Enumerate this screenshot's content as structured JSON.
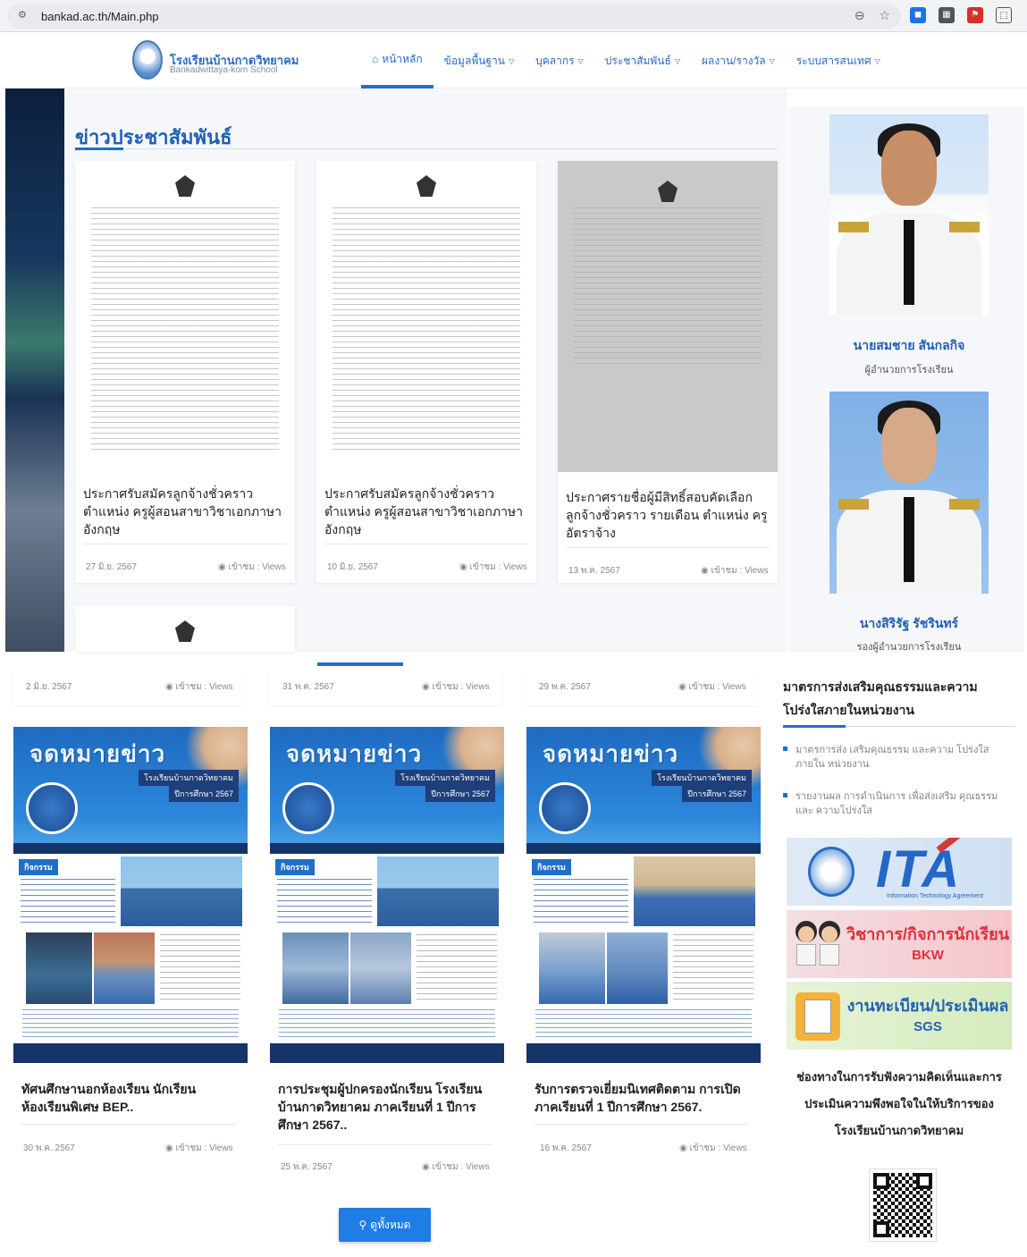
{
  "browser": {
    "url": "bankad.ac.th/Main.php"
  },
  "site": {
    "school_name": "โรงเรียนบ้านกาดวิทยาคม",
    "school_sub": "Bankadwittaya-kom School"
  },
  "nav": {
    "items": [
      {
        "label": "หน้าหลัก",
        "icon": "home-icon",
        "active": true,
        "dropdown": false
      },
      {
        "label": "ข้อมูลพื้นฐาน",
        "dropdown": true
      },
      {
        "label": "บุคลากร",
        "dropdown": true
      },
      {
        "label": "ประชาสัมพันธ์",
        "dropdown": true
      },
      {
        "label": "ผลงาน/รางวัล",
        "dropdown": true
      },
      {
        "label": "ระบบสารสนเทศ",
        "dropdown": true
      }
    ]
  },
  "news": {
    "section_title": "ข่าวประชาสัมพันธ์",
    "cards": [
      {
        "title": "ประกาศรับสมัครลูกจ้างชั่วคราว ตำแหน่ง ครูผู้สอนสาขาวิชาเอกภาษาอังกฤษ",
        "date": "27 มิ.ย. 2567",
        "views": "เข้าชม : Views"
      },
      {
        "title": "ประกาศรับสมัครลูกจ้างชั่วคราว ตำแหน่ง ครูผู้สอนสาขาวิชาเอกภาษาอังกฤษ",
        "date": "10 มิ.ย. 2567",
        "views": "เข้าชม : Views"
      },
      {
        "title": "ประกาศรายชื่อผู้มีสิทธิ์สอบคัดเลือก ลูกจ้างชั่วคราว รายเดือน ตำแหน่ง ครูอัตราจ้าง",
        "date": "13 พ.ค. 2567",
        "views": "เข้าชม : Views"
      }
    ],
    "strip": [
      {
        "date": "2 มิ.ย. 2567",
        "views": "เข้าชม : Views"
      },
      {
        "date": "31 พ.ค. 2567",
        "views": "เข้าชม : Views"
      },
      {
        "date": "29 พ.ค. 2567",
        "views": "เข้าชม : Views"
      }
    ]
  },
  "staff": [
    {
      "name": "นายสมชาย สันกลกิจ",
      "role": "ผู้อำนวยการโรงเรียน"
    },
    {
      "name": "นางสิริรัฐ รัชรินทร์",
      "role": "รองผู้อำนวยการโรงเรียน"
    }
  ],
  "newsletters": {
    "poster_head": "จดหมายข่าว",
    "poster_tag": "โรงเรียนบ้านกาดวิทยาคม",
    "poster_tag2": "ปีการศึกษา 2567",
    "poster_activity": "กิจกรรม",
    "items": [
      {
        "title": "ทัศนศึกษานอกห้องเรียน นักเรียนห้องเรียนพิเศษ BEP..",
        "date": "30 พ.ค. 2567",
        "views": "เข้าชม : Views"
      },
      {
        "title": "การประชุมผู้ปกครองนักเรียน โรงเรียนบ้านกาดวิทยาคม ภาคเรียนที่ 1 ปีการศึกษา 2567..",
        "date": "25 พ.ค. 2567",
        "views": "เข้าชม : Views"
      },
      {
        "title": "รับการตรวจเยี่ยมนิเทศติดตาม การเปิดภาคเรียนที่ 1 ปีการศึกษา 2567.",
        "date": "16 พ.ค. 2567",
        "views": "เข้าชม : Views"
      }
    ]
  },
  "more_button": "ดูทั้งหมด",
  "sidebar": {
    "heading": "มาตรการส่งเสริมคุณธรรมและความโปร่งใสภายในหน่วยงาน",
    "links": [
      "มาตรการส่ง เสริมคุณธรรม และความ โปร่งใส ภายใน หน่วยงาน",
      "รายงานผล การดำเนินการ เพื่อส่งเสริม คุณธรรม และ ความโปร่งใส"
    ],
    "ita": {
      "text": "ITA",
      "sub": "Information Technology Agreement"
    },
    "bkw": {
      "line1": "วิชาการ/กิจการนักเรียน",
      "line2": "BKW"
    },
    "sgs": {
      "line1": "งานทะเบียน/ประเมินผล",
      "line2": "SGS"
    },
    "feedback": "ช่องทางในการรับฟังความคิดเห็นและการประเมินความพึงพอใจในให้บริการของโรงเรียนบ้านกาดวิทยาคม"
  },
  "colors": {
    "accent": "#1f6fc9",
    "title_blue": "#1f5fb5",
    "banner_red": "#e0303a"
  }
}
